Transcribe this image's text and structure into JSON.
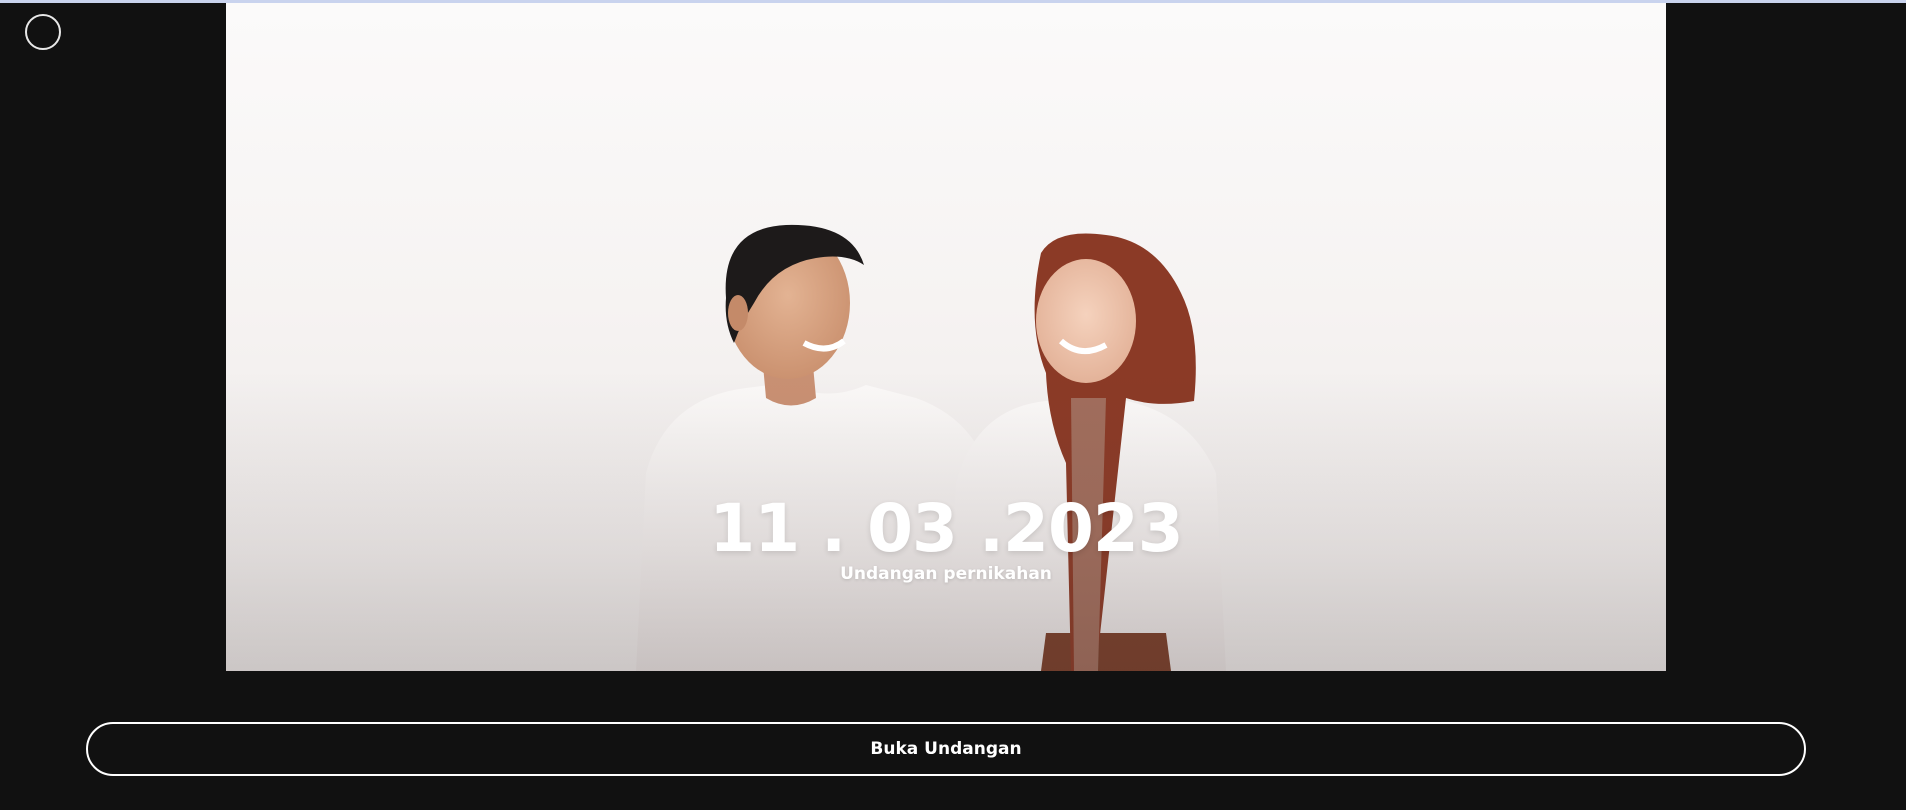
{
  "hero": {
    "date": "11 . 03 .2023",
    "subtitle": "Undangan pernikahan",
    "photo_alt": "couple-photo"
  },
  "actions": {
    "open_label": "Buka Undangan"
  },
  "colors": {
    "page_background": "#111111",
    "accent_border": "#ffffff",
    "scarf": "#8b3a26",
    "shirt": "#f3efee"
  }
}
